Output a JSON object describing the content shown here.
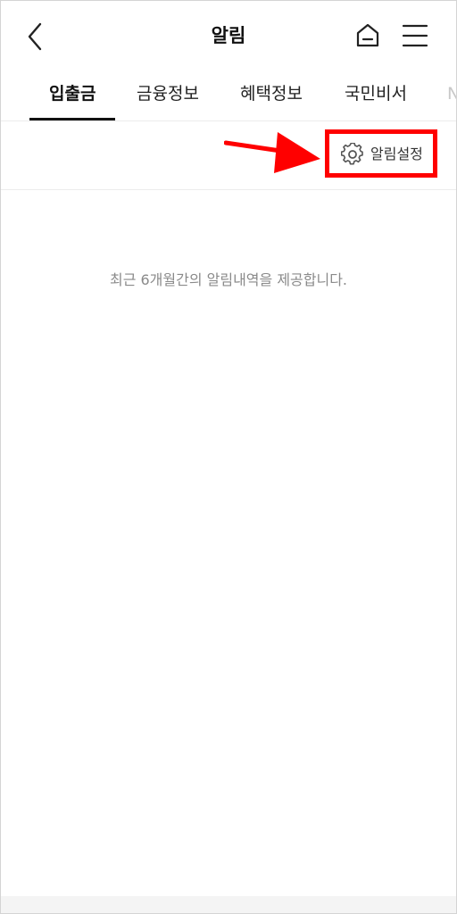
{
  "header": {
    "title": "알림",
    "back_icon": "chevron-left-icon",
    "home_icon": "home-icon",
    "menu_icon": "hamburger-menu-icon"
  },
  "tabs": [
    {
      "label": "입출금",
      "active": true
    },
    {
      "label": "금융정보",
      "active": false
    },
    {
      "label": "혜택정보",
      "active": false
    },
    {
      "label": "국민비서",
      "active": false
    },
    {
      "label": "N",
      "active": false
    }
  ],
  "settings": {
    "label": "알림설정",
    "icon": "gear-icon",
    "highlight_color": "#ff0000"
  },
  "empty_message": "최근 6개월간의 알림내역을 제공합니다."
}
